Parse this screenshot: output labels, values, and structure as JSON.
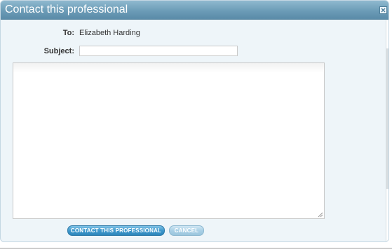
{
  "dialog": {
    "title": "Contact this professional",
    "close_icon": "close-icon"
  },
  "form": {
    "to_label": "To:",
    "to_value": "Elizabeth Harding",
    "subject_label": "Subject:",
    "subject_value": "",
    "message_value": ""
  },
  "actions": {
    "contact_label": "CONTACT THIS PROFESSIONAL",
    "cancel_label": "CANCEL"
  },
  "colors": {
    "titlebar": "#6c9cb7",
    "dialog_bg": "#eef5f9",
    "primary_button": "#3e98cc",
    "cancel_button": "#a9d0e6"
  }
}
